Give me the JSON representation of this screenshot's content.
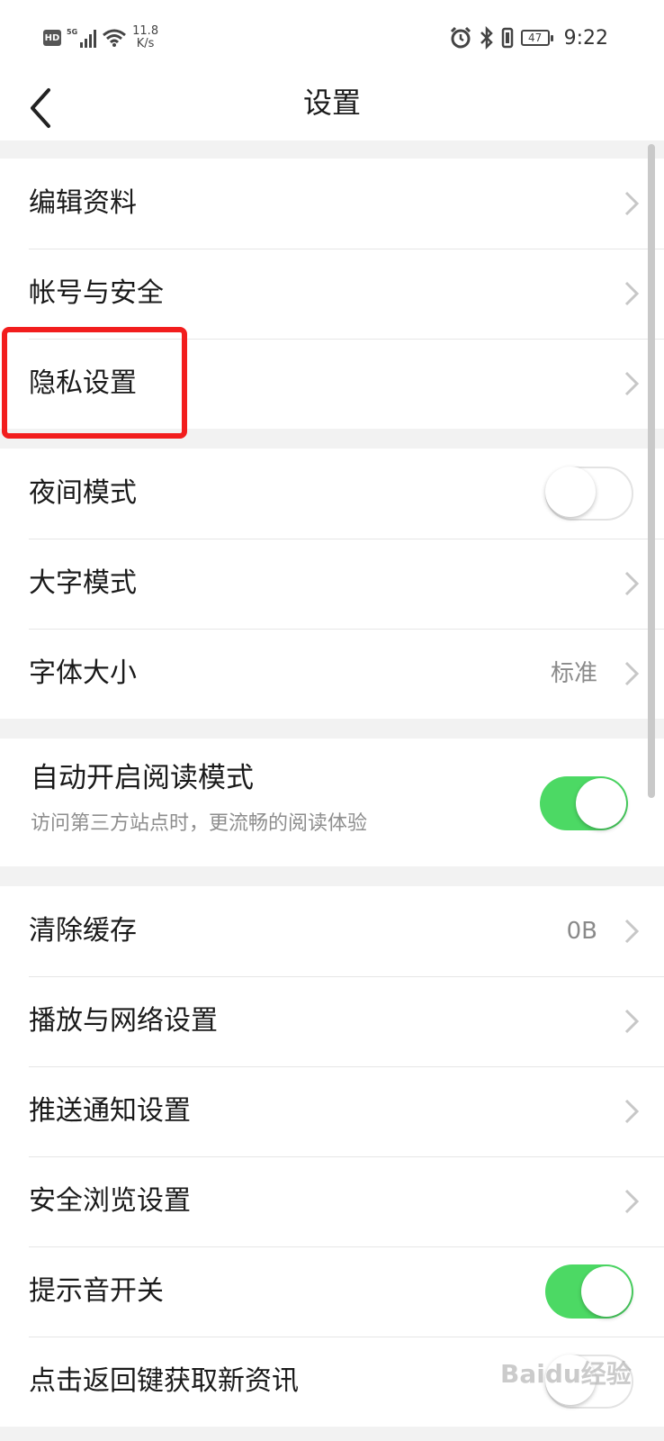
{
  "status_bar": {
    "hd": "HD",
    "network": "5G",
    "speed_value": "11.8",
    "speed_unit": "K/s",
    "battery": "47",
    "time": "9:22"
  },
  "nav": {
    "title": "设置"
  },
  "groups": {
    "account": [
      "编辑资料",
      "帐号与安全",
      "隐私设置"
    ],
    "display": {
      "night_mode": "夜间模式",
      "large_text": "大字模式",
      "font_size": "字体大小",
      "font_size_value": "标准"
    },
    "reading": {
      "title": "自动开启阅读模式",
      "desc": "访问第三方站点时，更流畅的阅读体验"
    },
    "other": {
      "clear_cache": "清除缓存",
      "cache_size": "0B",
      "playback": "播放与网络设置",
      "push": "推送通知设置",
      "safe_browse": "安全浏览设置",
      "sound": "提示音开关",
      "back_refresh": "点击返回键获取新资讯"
    }
  },
  "toggles": {
    "night_mode": false,
    "auto_reading": true,
    "sound": true,
    "back_refresh": false
  },
  "watermark": "Baidu经验",
  "colors": {
    "accent_green": "#4cd964",
    "highlight_red": "#f21d1d"
  }
}
